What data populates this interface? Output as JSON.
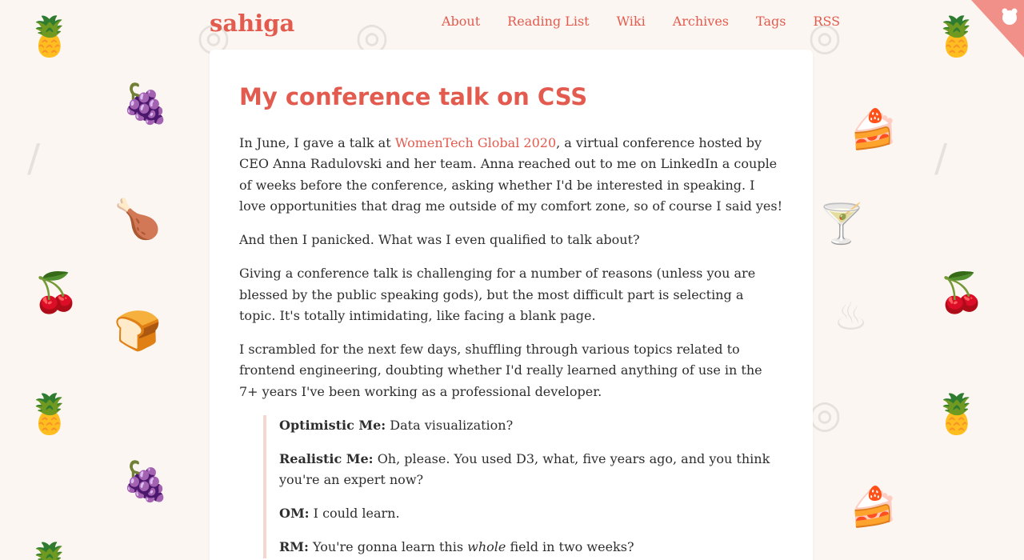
{
  "site": {
    "logo": "sahiga"
  },
  "nav": [
    "About",
    "Reading List",
    "Wiki",
    "Archives",
    "Tags",
    "RSS"
  ],
  "post": {
    "title": "My conference talk on CSS",
    "p1_before": "In June, I gave a talk at ",
    "p1_link": "WomenTech Global 2020",
    "p1_after": ", a virtual conference hosted by CEO Anna Radulovski and her team. Anna reached out to me on LinkedIn a couple of weeks before the conference, asking whether I'd be interested in speaking. I love opportunities that drag me outside of my comfort zone, so of course I said yes!",
    "p2": "And then I panicked. What was I even qualified to talk about?",
    "p3": "Giving a conference talk is challenging for a number of reasons (unless you are blessed by the public speaking gods), but the most difficult part is selecting a topic. It's totally intimidating, like facing a blank page.",
    "p4": "I scrambled for the next few days, shuffling through various topics related to frontend engineering, doubting whether I'd really learned anything of use in the 7+ years I've been working as a professional developer.",
    "dialogue": [
      {
        "speaker": "Optimistic Me:",
        "text": "Data visualization?"
      },
      {
        "speaker": "Realistic Me:",
        "text": "Oh, please. You used D3, what, five years ago, and you think you're an expert now?"
      },
      {
        "speaker": "OM:",
        "text": "I could learn."
      },
      {
        "speaker": "RM:",
        "text_before": "You're gonna learn this ",
        "text_em": "whole",
        "text_after": " field in two weeks?"
      }
    ]
  },
  "colors": {
    "accent": "#e35b4f",
    "background": "#fbf6f1",
    "card": "#ffffff",
    "quote_border": "#f6d7cd"
  },
  "icons": [
    "pineapple-icon",
    "grapes-icon",
    "cherry-icon",
    "asparagus-icon",
    "roast-chicken-icon",
    "cocktail-icon",
    "grill-icon",
    "donut-icon",
    "cake-icon",
    "bread-icon",
    "corner-ribbon-icon"
  ]
}
